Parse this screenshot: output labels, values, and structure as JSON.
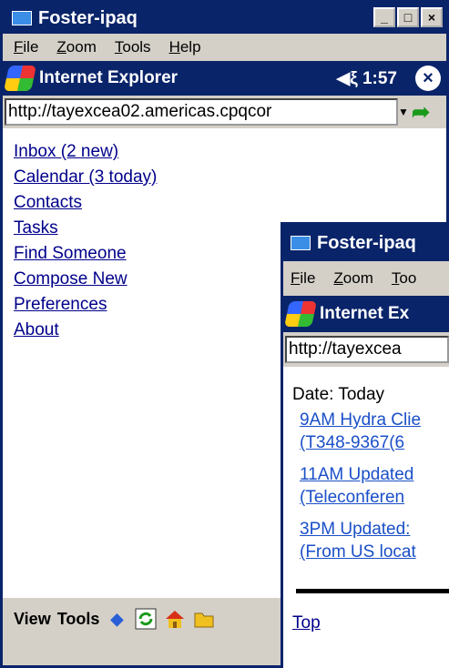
{
  "window1": {
    "title": "Foster-ipaq",
    "controls": {
      "minimize": "_",
      "maximize": "□",
      "close": "×"
    },
    "menu": [
      "File",
      "Zoom",
      "Tools",
      "Help"
    ],
    "ie": {
      "title": "Internet Explorer",
      "status": "◀ξ 1:57",
      "close": "×"
    },
    "address": "http://tayexcea02.americas.cpqcor",
    "links": [
      "Inbox (2 new)",
      "Calendar (3 today)",
      "Contacts",
      "Tasks",
      "Find Someone",
      "Compose New",
      "Preferences",
      "About"
    ],
    "bottom": {
      "view": "View",
      "tools": "Tools"
    }
  },
  "window2": {
    "title": "Foster-ipaq",
    "menu": [
      "File",
      "Zoom",
      "Too"
    ],
    "ie": {
      "title": "Internet Ex"
    },
    "address": "http://tayexcea",
    "date_label": "Date: Today",
    "events": [
      {
        "line1": "9AM Hydra Clie",
        "line2": "(T348-9367(6"
      },
      {
        "line1": "11AM Updated",
        "line2": "(Teleconferen"
      },
      {
        "line1": "3PM Updated:",
        "line2": "(From US locat"
      }
    ],
    "top_link": "Top"
  },
  "colors": {
    "title_bar": "#0a246a",
    "chrome": "#d4d0c8",
    "link": "#00008b",
    "go_arrow": "#1a9a1a"
  }
}
